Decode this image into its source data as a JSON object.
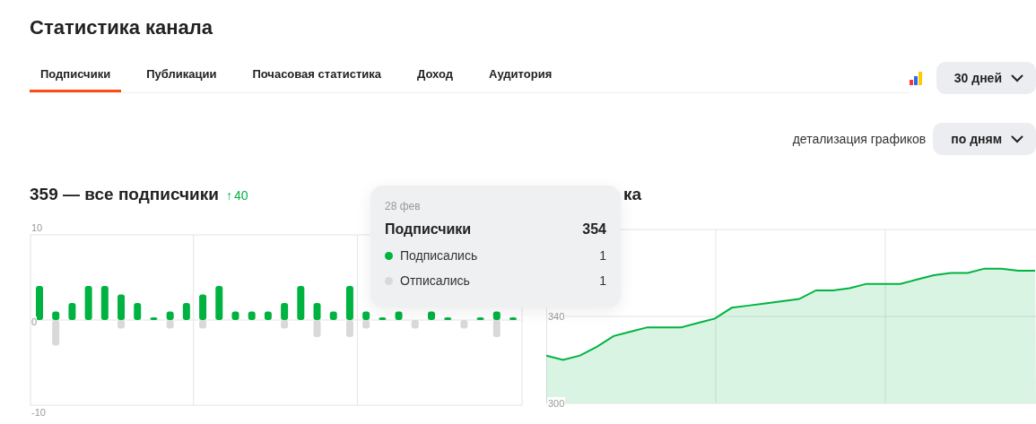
{
  "title": "Статистика канала",
  "tabs": [
    {
      "label": "Подписчики",
      "selected": true
    },
    {
      "label": "Публикации",
      "selected": false
    },
    {
      "label": "Почасовая статистика",
      "selected": false
    },
    {
      "label": "Доход",
      "selected": false
    },
    {
      "label": "Аудитория",
      "selected": false
    }
  ],
  "period": {
    "value": "30 дней"
  },
  "detail": {
    "label": "детализация графиков",
    "value": "по дням"
  },
  "subscribers_chart": {
    "total": "359 — все подписчики",
    "delta_icon": "↑",
    "delta": "40",
    "chart_data": {
      "type": "bar",
      "stacked": true,
      "grid": true,
      "ylim": [
        -10,
        10
      ],
      "yticks": [
        -10,
        0,
        10
      ],
      "series": [
        {
          "name": "Подписались",
          "color": "#00b341",
          "values": [
            4,
            1,
            2,
            4,
            4,
            3,
            2,
            0,
            1,
            2,
            3,
            4,
            1,
            1,
            1,
            2,
            4,
            2,
            1,
            4,
            1,
            0,
            1,
            null,
            1,
            0,
            null,
            0,
            1,
            0
          ]
        },
        {
          "name": "Отписались",
          "color": "#d9d9d9",
          "values": [
            0,
            -3,
            0,
            0,
            0,
            -1,
            0,
            0,
            -1,
            0,
            -1,
            0,
            0,
            0,
            0,
            -1,
            0,
            -2,
            0,
            -2,
            -1,
            0,
            0,
            -1,
            0,
            0,
            -1,
            0,
            -2,
            0
          ]
        }
      ]
    }
  },
  "dynamics_chart": {
    "title": "ка",
    "chart_data": {
      "type": "area",
      "grid": true,
      "ylim": [
        300,
        380
      ],
      "yticks": [
        300,
        340
      ],
      "series": [
        {
          "name": "Подписчики",
          "color": "#00b341",
          "values": [
            322,
            320,
            322,
            326,
            331,
            333,
            335,
            335,
            335,
            337,
            339,
            344,
            345,
            346,
            347,
            348,
            352,
            352,
            353,
            355,
            355,
            355,
            357,
            359,
            360,
            360,
            362,
            362,
            361,
            361
          ]
        }
      ]
    }
  },
  "tooltip": {
    "date": "28 фев",
    "value": "354",
    "rows": [
      {
        "value": "1"
      },
      {
        "value": "1"
      }
    ]
  }
}
